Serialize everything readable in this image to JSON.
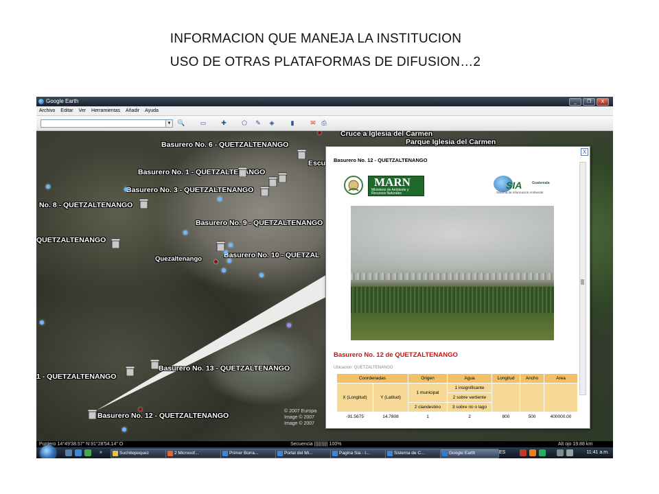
{
  "slide": {
    "title_line1": "INFORMACION QUE MANEJA LA INSTITUCION",
    "title_line2": "USO DE OTRAS PLATAFORMAS DE DIFUSION…2"
  },
  "window": {
    "title": "Google Earth",
    "menu": [
      "Archivo",
      "Editar",
      "Ver",
      "Herramientas",
      "Añadir",
      "Ayuda"
    ],
    "controls": {
      "minimize": "_",
      "maximize": "❐",
      "close": "X"
    }
  },
  "map": {
    "labels": {
      "cruce": "Cruce a Iglesia del Carmen",
      "parque": "Parque Iglesia del Carmen",
      "b6": "Basurero No. 6 - QUETZALTENANGO",
      "b1": "Basurero No. 1 - QUETZALTENANGO",
      "b3": "Basurero No. 3 - QUETZALTENANGO",
      "b8": "No. 8 - QUETZALTENANGO",
      "b9": "Basurero No. 9 - QUETZALTENANGO",
      "bq": "QUETZALTENANGO",
      "b10": "Basurero No. 10 - QUETZAL",
      "city": "Quezaltenango",
      "b11": "1 - QUETZALTENANGO",
      "b13": "Basurero No. 13 - QUETZALTENANGO",
      "b12": "Basurero No. 12 - QUETZALTENANGO",
      "escu": "Escu"
    },
    "copyright": [
      "© 2007 Europa",
      "Image © 2007",
      "Image © 2007"
    ]
  },
  "popup": {
    "heading": "Basurero No. 12 - QUETZALTENANGO",
    "marn_word": "MARN",
    "marn_sub": "Ministerio de Ambiente y Recursos Naturales",
    "sia_word": "SIA",
    "sia_country": "Guatemala",
    "sia_sub": "Sistema de Información Ambiental",
    "subtitle": "Basurero No. 12 de QUETZALTENANGO",
    "location": "Ubicacion: QUETZALTENANGO",
    "close": "X",
    "table": {
      "headers": {
        "coords": "Coordenadas",
        "origen": "Origen",
        "agua": "Agua",
        "longitud": "Longitud",
        "ancho": "Ancho",
        "area": "Area"
      },
      "sub_headers": {
        "x": "X (Longitud)",
        "y": "Y (Latitud)"
      },
      "origen_options": [
        "1 municipal",
        "2 clandestino"
      ],
      "agua_options": [
        "1 insignificante",
        "2 sobre vertiente",
        "3 sobre rio o lago"
      ],
      "values": {
        "x": "-91.5675",
        "y": "14.7808",
        "origen": "1",
        "agua": "2",
        "longitud": "800",
        "ancho": "500",
        "area": "400000.00"
      }
    }
  },
  "statusbar": {
    "pointer": "Puntero   14°49'38.57\"  N   91°28'54.14\"   O",
    "sequence": "Secuencia  ||||||||||| 100%",
    "altitude": "Alt ojo   19.88 km"
  },
  "taskbar": {
    "items": [
      "Suchitepequez",
      "2 Microsof...",
      "Primer Borra...",
      "Portal del Mi...",
      "Pagina Sia - I...",
      "Sistema de C...",
      "Google Earth"
    ],
    "lang": "ES",
    "clock": "11:41 a.m.",
    "chevron": "»"
  }
}
